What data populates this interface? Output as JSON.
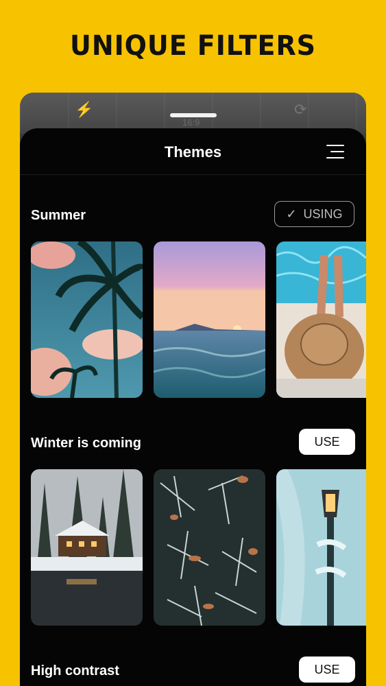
{
  "headline": "UNIQUE FILTERS",
  "camera": {
    "ratio": "16:9"
  },
  "sheet": {
    "title": "Themes"
  },
  "sections": [
    {
      "title": "Summer",
      "action": "USING",
      "active": true,
      "thumbs": [
        "palm-trees-sky",
        "ocean-sunset",
        "pool-straw-hat"
      ]
    },
    {
      "title": "Winter is coming",
      "action": "USE",
      "active": false,
      "thumbs": [
        "snowy-cabin-lake",
        "frosted-pine-branches",
        "frozen-street-lamp"
      ]
    },
    {
      "title": "High contrast",
      "action": "USE",
      "active": false,
      "thumbs": []
    }
  ],
  "colors": {
    "background": "#F7C200",
    "sheet": "#050505",
    "button": "#FFFFFF"
  }
}
